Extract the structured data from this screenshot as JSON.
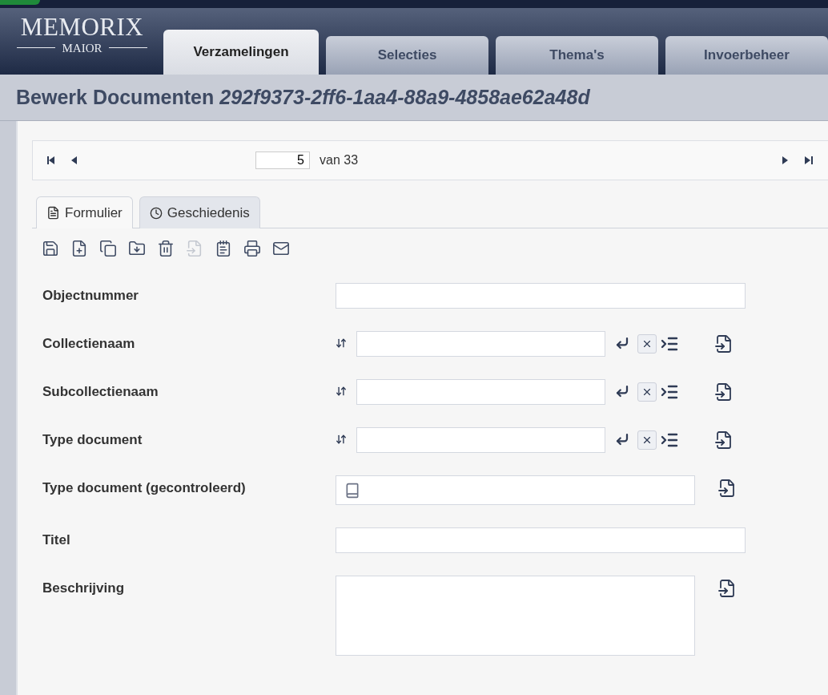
{
  "logo": {
    "name": "MEMORIX",
    "sub": "MAIOR"
  },
  "main_tabs": [
    {
      "label": "Verzamelingen",
      "selected": true
    },
    {
      "label": "Selecties",
      "selected": false
    },
    {
      "label": "Thema's",
      "selected": false
    },
    {
      "label": "Invoerbeheer",
      "selected": false
    }
  ],
  "title": {
    "text": "Bewerk Documenten",
    "id": "292f9373-2ff6-1aa4-88a9-4858ae62a48d"
  },
  "pager": {
    "current": "5",
    "total": "van 33"
  },
  "form_tabs": [
    {
      "label": "Formulier",
      "kind": "form",
      "selected": true
    },
    {
      "label": "Geschiedenis",
      "kind": "history",
      "selected": false
    }
  ],
  "toolbar": [
    {
      "kind": "save",
      "disabled": false
    },
    {
      "kind": "new",
      "disabled": false
    },
    {
      "kind": "copy",
      "disabled": false
    },
    {
      "kind": "folder",
      "disabled": false
    },
    {
      "kind": "delete",
      "disabled": false
    },
    {
      "kind": "import",
      "disabled": true
    },
    {
      "kind": "notes",
      "disabled": false
    },
    {
      "kind": "print",
      "disabled": false
    },
    {
      "kind": "mail",
      "disabled": false
    }
  ],
  "fields": [
    {
      "label": "Objectnummer",
      "kind": "text",
      "copy": false
    },
    {
      "label": "Collectienaam",
      "kind": "lookup",
      "copy": true
    },
    {
      "label": "Subcollectienaam",
      "kind": "lookup",
      "copy": true
    },
    {
      "label": "Type document",
      "kind": "lookup",
      "copy": true
    },
    {
      "label": "Type document (gecontroleerd)",
      "kind": "controlled",
      "copy": true
    },
    {
      "label": "Titel",
      "kind": "text",
      "copy": false
    },
    {
      "label": "Beschrijving",
      "kind": "textarea",
      "copy": true
    }
  ]
}
